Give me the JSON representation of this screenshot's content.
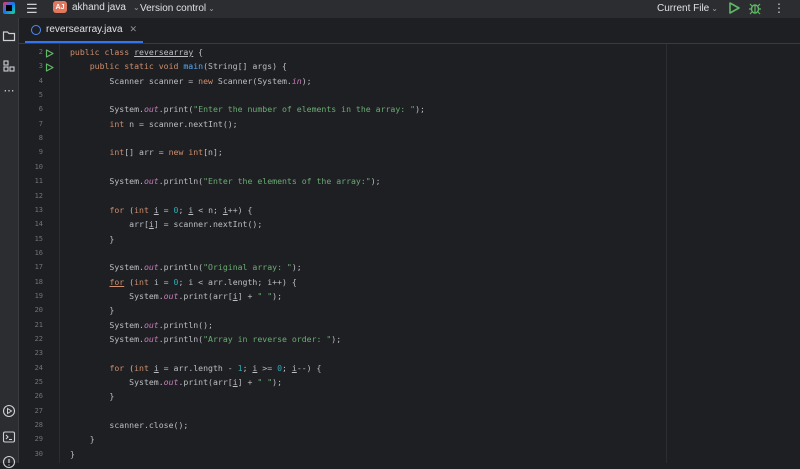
{
  "titlebar": {
    "project_initials": "AJ",
    "project_name": "akhand java",
    "vcs_label": "Version control",
    "run_config": "Current File"
  },
  "tab": {
    "filename": "reversearray.java"
  },
  "colors": {
    "background": "#1e1f22",
    "keyword": "#cf8e6d",
    "function": "#56a8f5",
    "string": "#6aab73",
    "static_field": "#c77dbb",
    "number": "#2aacb8",
    "run_green": "#5fb865"
  },
  "gutter": [
    "2",
    "3",
    "4",
    "5",
    "6",
    "7",
    "8",
    "9",
    "10",
    "11",
    "12",
    "13",
    "14",
    "15",
    "16",
    "17",
    "18",
    "19",
    "20",
    "21",
    "22",
    "23",
    "24",
    "25",
    "26",
    "27",
    "28",
    "29",
    "30"
  ],
  "code": [
    [
      {
        "t": "public class ",
        "c": "kw"
      },
      {
        "t": "reversearray",
        "c": "ul"
      },
      {
        "t": " {"
      }
    ],
    [
      {
        "t": "    public static void ",
        "c": "kw"
      },
      {
        "t": "main",
        "c": "fn"
      },
      {
        "t": "(String[] args) {"
      }
    ],
    [
      {
        "t": "        Scanner scanner = "
      },
      {
        "t": "new ",
        "c": "kw"
      },
      {
        "t": "Scanner(System."
      },
      {
        "t": "in",
        "c": "fld"
      },
      {
        "t": ");"
      }
    ],
    [],
    [
      {
        "t": "        System."
      },
      {
        "t": "out",
        "c": "fld"
      },
      {
        "t": ".print("
      },
      {
        "t": "\"Enter the number of elements in the array: \"",
        "c": "str"
      },
      {
        "t": ");"
      }
    ],
    [
      {
        "t": "        "
      },
      {
        "t": "int ",
        "c": "kw"
      },
      {
        "t": "n = scanner.nextInt();"
      }
    ],
    [],
    [
      {
        "t": "        "
      },
      {
        "t": "int",
        "c": "kw"
      },
      {
        "t": "[] arr = "
      },
      {
        "t": "new int",
        "c": "kw"
      },
      {
        "t": "[n];"
      }
    ],
    [],
    [
      {
        "t": "        System."
      },
      {
        "t": "out",
        "c": "fld"
      },
      {
        "t": ".println("
      },
      {
        "t": "\"Enter the elements of the array:\"",
        "c": "str"
      },
      {
        "t": ");"
      }
    ],
    [],
    [
      {
        "t": "        "
      },
      {
        "t": "for ",
        "c": "kw"
      },
      {
        "t": "("
      },
      {
        "t": "int ",
        "c": "kw"
      },
      {
        "t": "i",
        "c": "ul"
      },
      {
        "t": " = "
      },
      {
        "t": "0",
        "c": "num"
      },
      {
        "t": "; "
      },
      {
        "t": "i",
        "c": "ul"
      },
      {
        "t": " < n; "
      },
      {
        "t": "i",
        "c": "ul"
      },
      {
        "t": "++) {"
      }
    ],
    [
      {
        "t": "            arr["
      },
      {
        "t": "i",
        "c": "ul"
      },
      {
        "t": "] = scanner.nextInt();"
      }
    ],
    [
      {
        "t": "        }"
      }
    ],
    [],
    [
      {
        "t": "        System."
      },
      {
        "t": "out",
        "c": "fld"
      },
      {
        "t": ".println("
      },
      {
        "t": "\"Original array: \"",
        "c": "str"
      },
      {
        "t": ");"
      }
    ],
    [
      {
        "t": "        "
      },
      {
        "t": "for",
        "c": "kw ul"
      },
      {
        "t": " ("
      },
      {
        "t": "int ",
        "c": "kw"
      },
      {
        "t": "i = "
      },
      {
        "t": "0",
        "c": "num"
      },
      {
        "t": "; i < arr.length; i++) {"
      }
    ],
    [
      {
        "t": "            System."
      },
      {
        "t": "out",
        "c": "fld"
      },
      {
        "t": ".print(arr["
      },
      {
        "t": "i",
        "c": "ul"
      },
      {
        "t": "] + "
      },
      {
        "t": "\" \"",
        "c": "str"
      },
      {
        "t": ");"
      }
    ],
    [
      {
        "t": "        }"
      }
    ],
    [
      {
        "t": "        System."
      },
      {
        "t": "out",
        "c": "fld"
      },
      {
        "t": ".println();"
      }
    ],
    [
      {
        "t": "        System."
      },
      {
        "t": "out",
        "c": "fld"
      },
      {
        "t": ".println("
      },
      {
        "t": "\"Array in reverse order: \"",
        "c": "str"
      },
      {
        "t": ");"
      }
    ],
    [],
    [
      {
        "t": "        "
      },
      {
        "t": "for ",
        "c": "kw"
      },
      {
        "t": "("
      },
      {
        "t": "int ",
        "c": "kw"
      },
      {
        "t": "i",
        "c": "ul"
      },
      {
        "t": " = arr.length - "
      },
      {
        "t": "1",
        "c": "num"
      },
      {
        "t": "; "
      },
      {
        "t": "i",
        "c": "ul"
      },
      {
        "t": " >= "
      },
      {
        "t": "0",
        "c": "num"
      },
      {
        "t": "; "
      },
      {
        "t": "i",
        "c": "ul"
      },
      {
        "t": "--) {"
      }
    ],
    [
      {
        "t": "            System."
      },
      {
        "t": "out",
        "c": "fld"
      },
      {
        "t": ".print(arr["
      },
      {
        "t": "i",
        "c": "ul"
      },
      {
        "t": "] + "
      },
      {
        "t": "\" \"",
        "c": "str"
      },
      {
        "t": ");"
      }
    ],
    [
      {
        "t": "        }"
      }
    ],
    [],
    [
      {
        "t": "        scanner.close();"
      }
    ],
    [
      {
        "t": "    }"
      }
    ],
    [
      {
        "t": "}"
      }
    ]
  ]
}
